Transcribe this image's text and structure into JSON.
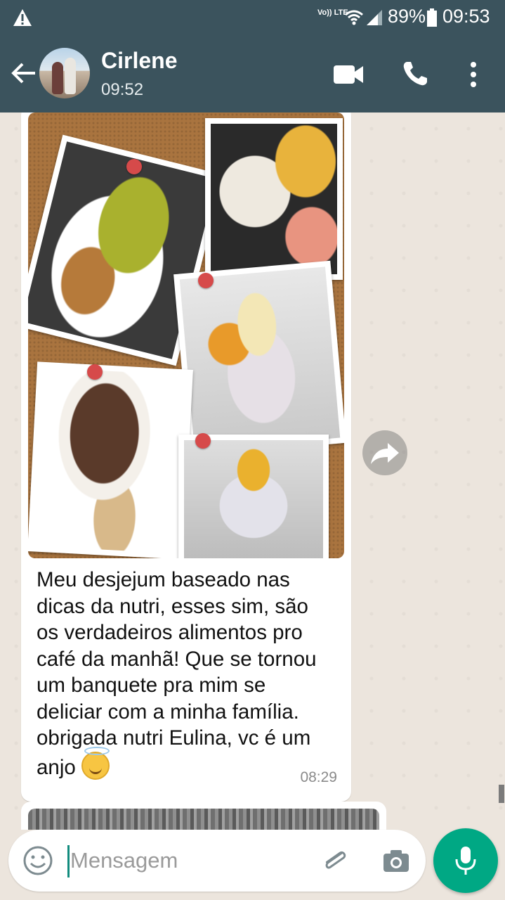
{
  "status_bar": {
    "network_label": "Vo)) LTE",
    "battery_percent": "89%",
    "time": "09:53"
  },
  "header": {
    "contact_name": "Cirlene",
    "last_seen": "09:52"
  },
  "icons": {
    "alert": "alert-triangle-icon",
    "back": "arrow-left-icon",
    "video": "video-camera-icon",
    "call": "phone-icon",
    "menu": "more-vertical-icon",
    "forward": "forward-arrow-icon",
    "emoji": "emoji-smiley-icon",
    "attach": "paperclip-icon",
    "camera": "camera-icon",
    "mic": "microphone-icon"
  },
  "message": {
    "text_lines": [
      "Meu desjejum baseado nas",
      "dicas da nutri,  esses sim, são",
      "os verdadeiros alimentos pro",
      "café da manhã! Que se tornou",
      "um banquete pra mim se",
      "deliciar com a minha família.",
      "obrigada nutri Eulina, vc é um",
      "anjo"
    ],
    "time": "08:29"
  },
  "composer": {
    "placeholder": "Mensagem"
  },
  "colors": {
    "header": "#3B535D",
    "accent": "#00A884",
    "chat_bg": "#ECE5DD"
  }
}
